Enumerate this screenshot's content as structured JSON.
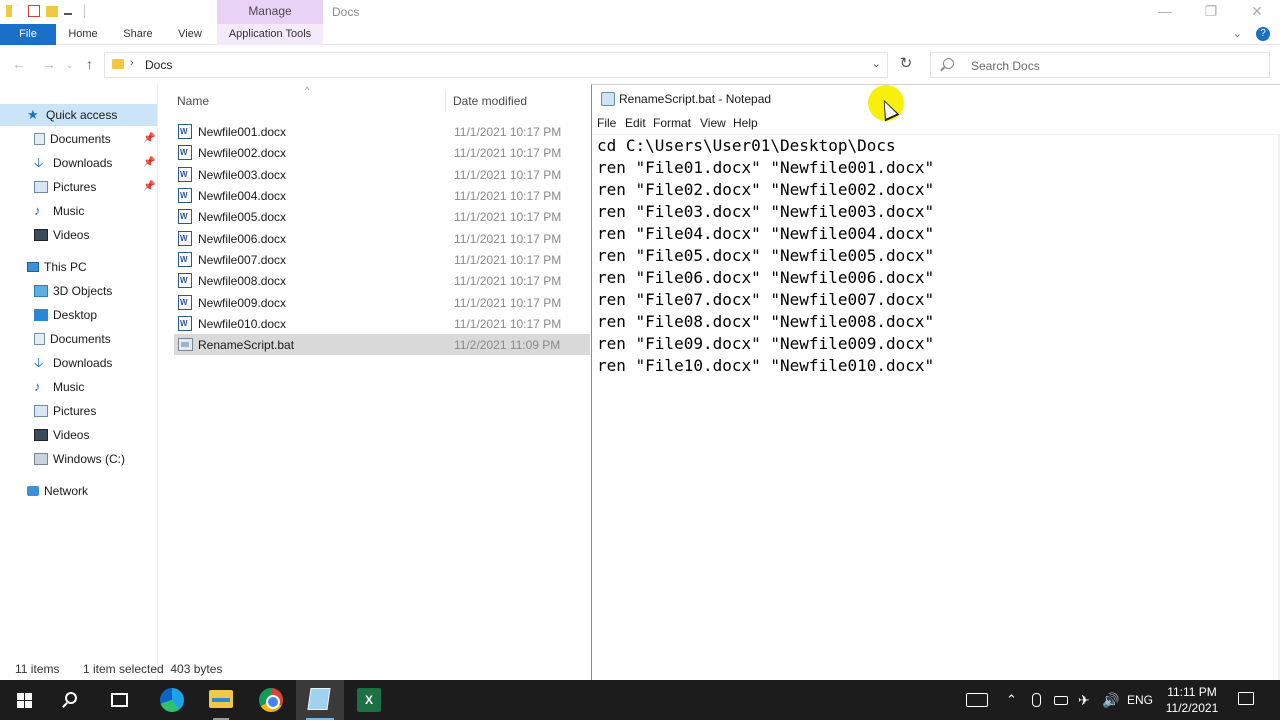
{
  "explorer": {
    "manage_tab": "Manage",
    "window_title": "Docs",
    "ribbon_tabs": [
      "File",
      "Home",
      "Share",
      "View",
      "Application Tools"
    ],
    "address": "Docs",
    "search_placeholder": "Search Docs",
    "columns": {
      "name": "Name",
      "date": "Date modified"
    },
    "sidebar": {
      "quick_access": "Quick access",
      "quick_items": [
        "Documents",
        "Downloads",
        "Pictures",
        "Music",
        "Videos"
      ],
      "this_pc": "This PC",
      "pc_items": [
        "3D Objects",
        "Desktop",
        "Documents",
        "Downloads",
        "Music",
        "Pictures",
        "Videos",
        "Windows (C:)"
      ],
      "network": "Network"
    },
    "files": [
      {
        "name": "Newfile001.docx",
        "date": "11/1/2021 10:17 PM"
      },
      {
        "name": "Newfile002.docx",
        "date": "11/1/2021 10:17 PM"
      },
      {
        "name": "Newfile003.docx",
        "date": "11/1/2021 10:17 PM"
      },
      {
        "name": "Newfile004.docx",
        "date": "11/1/2021 10:17 PM"
      },
      {
        "name": "Newfile005.docx",
        "date": "11/1/2021 10:17 PM"
      },
      {
        "name": "Newfile006.docx",
        "date": "11/1/2021 10:17 PM"
      },
      {
        "name": "Newfile007.docx",
        "date": "11/1/2021 10:17 PM"
      },
      {
        "name": "Newfile008.docx",
        "date": "11/1/2021 10:17 PM"
      },
      {
        "name": "Newfile009.docx",
        "date": "11/1/2021 10:17 PM"
      },
      {
        "name": "Newfile010.docx",
        "date": "11/1/2021 10:17 PM"
      },
      {
        "name": "RenameScript.bat",
        "date": "11/2/2021 11:09 PM"
      }
    ],
    "status": {
      "count": "11 items",
      "selection": "1 item selected  403 bytes"
    }
  },
  "notepad": {
    "title": "RenameScript.bat - Notepad",
    "menu": [
      "File",
      "Edit",
      "Format",
      "View",
      "Help"
    ],
    "lines": [
      "cd C:\\Users\\User01\\Desktop\\Docs",
      "ren \"File01.docx\" \"Newfile001.docx\"",
      "ren \"File02.docx\" \"Newfile002.docx\"",
      "ren \"File03.docx\" \"Newfile003.docx\"",
      "ren \"File04.docx\" \"Newfile004.docx\"",
      "ren \"File05.docx\" \"Newfile005.docx\"",
      "ren \"File06.docx\" \"Newfile006.docx\"",
      "ren \"File07.docx\" \"Newfile007.docx\"",
      "ren \"File08.docx\" \"Newfile008.docx\"",
      "ren \"File09.docx\" \"Newfile009.docx\"",
      "ren \"File10.docx\" \"Newfile010.docx\""
    ]
  },
  "taskbar": {
    "language": "ENG",
    "time": "11:11 PM",
    "date": "11/2/2021"
  }
}
